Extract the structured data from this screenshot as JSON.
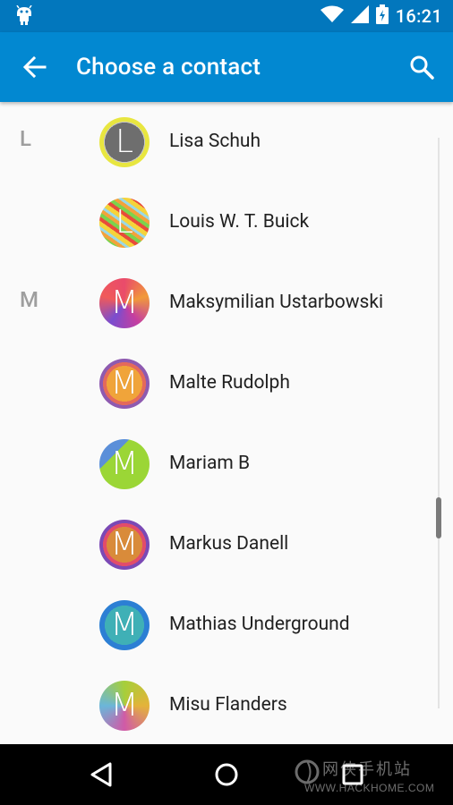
{
  "status_bar": {
    "time": "16:21",
    "icons": [
      "android-debug-icon",
      "wifi-icon",
      "cell-signal-icon",
      "battery-icon"
    ]
  },
  "app_bar": {
    "title": "Choose a contact",
    "back_icon": "arrow-back-icon",
    "search_icon": "search-icon",
    "color": "#0288d1"
  },
  "contacts": [
    {
      "section": "L",
      "initial": "L",
      "name": "Lisa Schuh"
    },
    {
      "section": "",
      "initial": "L",
      "name": "Louis W. T. Buick"
    },
    {
      "section": "M",
      "initial": "M",
      "name": "Maksymilian Ustarbowski"
    },
    {
      "section": "",
      "initial": "M",
      "name": "Malte Rudolph"
    },
    {
      "section": "",
      "initial": "M",
      "name": "Mariam B"
    },
    {
      "section": "",
      "initial": "M",
      "name": "Markus Danell"
    },
    {
      "section": "",
      "initial": "M",
      "name": "Mathias Underground"
    },
    {
      "section": "",
      "initial": "M",
      "name": "Misu Flanders"
    }
  ],
  "nav_bar": {
    "buttons": [
      "back-triangle-icon",
      "home-circle-icon",
      "recents-square-icon"
    ]
  },
  "watermark": {
    "top_text": "网侠手机站",
    "url": "WWW.HACKHOME.COM"
  }
}
